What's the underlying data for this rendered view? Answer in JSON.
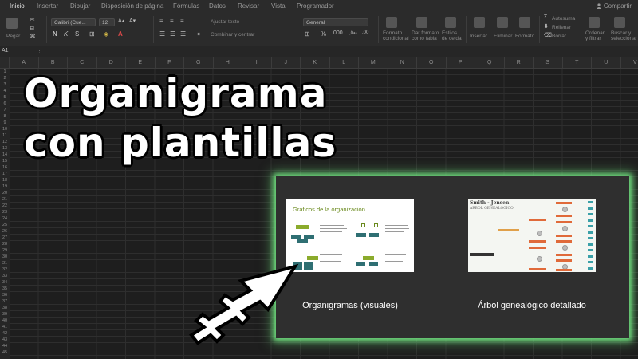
{
  "ribbon": {
    "tabs": [
      "Inicio",
      "Insertar",
      "Dibujar",
      "Disposición de página",
      "Fórmulas",
      "Datos",
      "Revisar",
      "Vista",
      "Programador"
    ],
    "share_label": "Compartir",
    "paste_label": "Pegar",
    "font_name": "Calibri (Cue...",
    "font_size": "12",
    "wrap_text_label": "Ajustar texto",
    "merge_label": "Combinar y centrar",
    "number_format": "General",
    "cond_format_label": "Formato condicional",
    "table_format_label": "Dar formato como tabla",
    "cell_styles_label": "Estilos de celda",
    "insert_label": "Insertar",
    "delete_label": "Eliminar",
    "format_label": "Formato",
    "autosum_label": "Autosuma",
    "fill_label": "Rellenar",
    "clear_label": "Borrar",
    "sort_label": "Ordenar y filtrar",
    "find_label": "Buscar y seleccionar"
  },
  "formula_bar": {
    "cell_ref": "A1"
  },
  "columns": [
    "A",
    "B",
    "C",
    "D",
    "E",
    "F",
    "G",
    "H",
    "I",
    "J",
    "K",
    "L",
    "M",
    "N",
    "O",
    "P",
    "Q",
    "R",
    "S",
    "T",
    "U",
    "V"
  ],
  "rows": [
    "1",
    "2",
    "3",
    "4",
    "5",
    "6",
    "7",
    "8",
    "9",
    "10",
    "11",
    "12",
    "13",
    "14",
    "15",
    "16",
    "17",
    "18",
    "19",
    "20",
    "21",
    "22",
    "23",
    "24",
    "25",
    "26",
    "27",
    "28",
    "29",
    "30",
    "31",
    "32",
    "33",
    "34",
    "35",
    "36",
    "37",
    "38",
    "39",
    "40",
    "41",
    "42",
    "43",
    "44",
    "45"
  ],
  "overlay": {
    "title_line1": "Organigrama",
    "title_line2": "con plantillas"
  },
  "templates": [
    {
      "caption": "Organigramas (visuales)",
      "thumb_title": "Gráficos de la organización"
    },
    {
      "caption": "Árbol genealógico detallado",
      "thumb_name": "Smith - Jensen",
      "thumb_sub": "ÁRBOL GENEALÓGICO"
    }
  ],
  "colors": {
    "accent_glow": "#6fdc7d",
    "panel_bg": "#2f2f2f",
    "org_green": "#8bab2c",
    "org_teal": "#2f6f73"
  }
}
